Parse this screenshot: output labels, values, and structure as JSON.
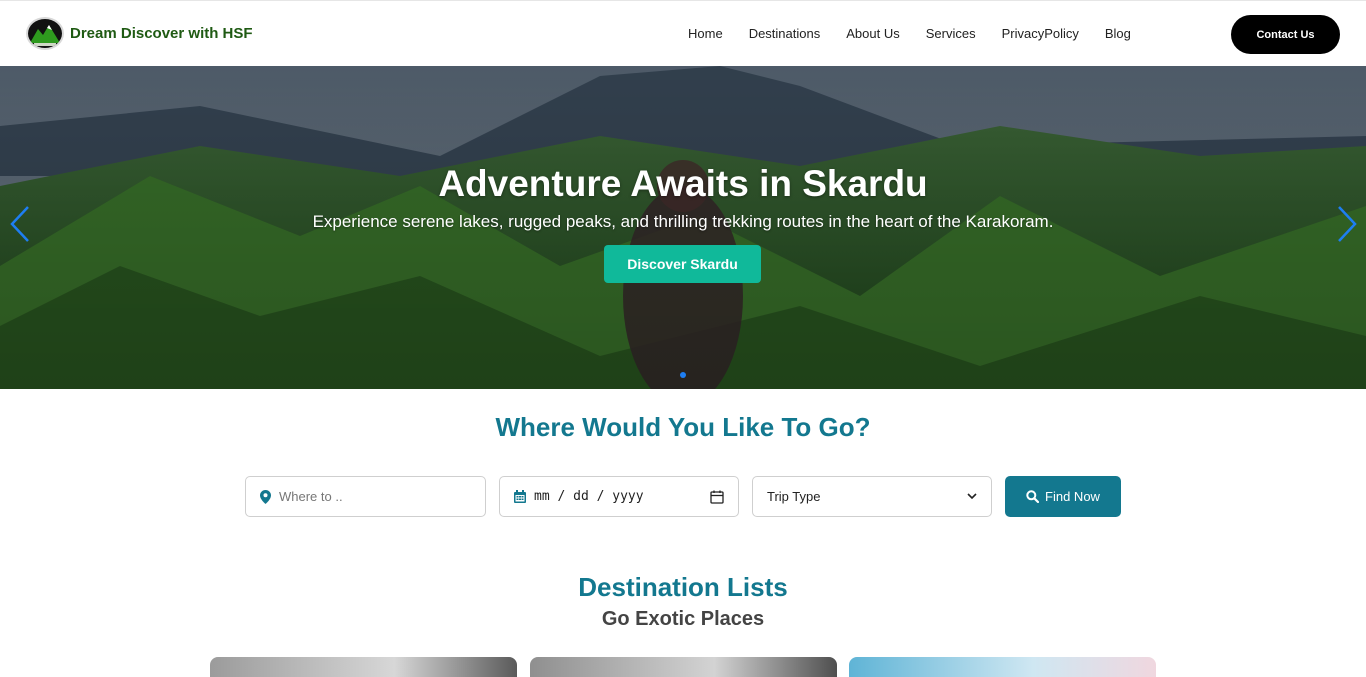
{
  "brand": {
    "name": "Dream Discover with HSF",
    "logo_icon": "mountain-logo-icon"
  },
  "nav": {
    "links": [
      "Home",
      "Destinations",
      "About Us",
      "Services",
      "PrivacyPolicy",
      "Blog"
    ],
    "contact_label": "Contact Us"
  },
  "hero": {
    "title": "Adventure Awaits in Skardu",
    "subtitle": "Experience serene lakes, rugged peaks, and thrilling trekking routes in the heart of the Karakoram.",
    "button_label": "Discover Skardu",
    "accent_color": "#10b99a"
  },
  "search": {
    "title": "Where Would You Like To Go?",
    "where_placeholder": "Where to ..",
    "date_placeholder": "mm / dd / yyyy",
    "trip_type_selected": "Trip Type",
    "find_label": "Find Now",
    "primary_color": "#13788f"
  },
  "destinations": {
    "title": "Destination Lists",
    "subtitle": "Go Exotic Places"
  }
}
